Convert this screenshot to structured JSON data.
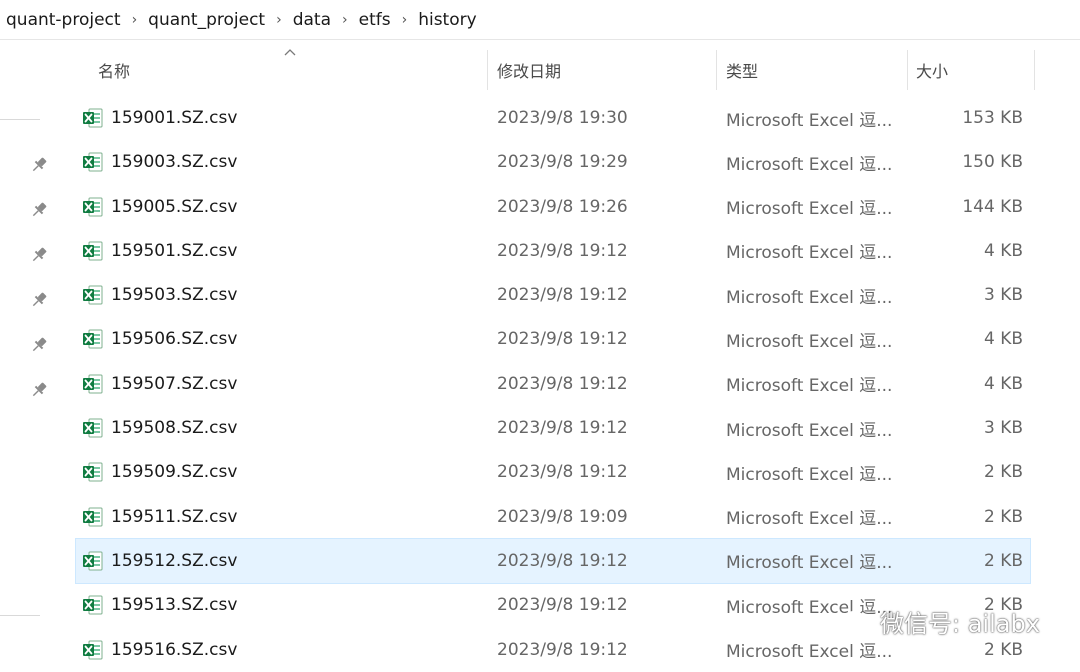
{
  "breadcrumb": {
    "items": [
      "quant-project",
      "quant_project",
      "data",
      "etfs",
      "history"
    ],
    "separator": "›"
  },
  "columns": {
    "name": "名称",
    "date": "修改日期",
    "type": "类型",
    "size": "大小"
  },
  "files": [
    {
      "name": "159001.SZ.csv",
      "date": "2023/9/8 19:30",
      "type": "Microsoft Excel 逗...",
      "size": "153 KB"
    },
    {
      "name": "159003.SZ.csv",
      "date": "2023/9/8 19:29",
      "type": "Microsoft Excel 逗...",
      "size": "150 KB"
    },
    {
      "name": "159005.SZ.csv",
      "date": "2023/9/8 19:26",
      "type": "Microsoft Excel 逗...",
      "size": "144 KB"
    },
    {
      "name": "159501.SZ.csv",
      "date": "2023/9/8 19:12",
      "type": "Microsoft Excel 逗...",
      "size": "4 KB"
    },
    {
      "name": "159503.SZ.csv",
      "date": "2023/9/8 19:12",
      "type": "Microsoft Excel 逗...",
      "size": "3 KB"
    },
    {
      "name": "159506.SZ.csv",
      "date": "2023/9/8 19:12",
      "type": "Microsoft Excel 逗...",
      "size": "4 KB"
    },
    {
      "name": "159507.SZ.csv",
      "date": "2023/9/8 19:12",
      "type": "Microsoft Excel 逗...",
      "size": "4 KB"
    },
    {
      "name": "159508.SZ.csv",
      "date": "2023/9/8 19:12",
      "type": "Microsoft Excel 逗...",
      "size": "3 KB"
    },
    {
      "name": "159509.SZ.csv",
      "date": "2023/9/8 19:12",
      "type": "Microsoft Excel 逗...",
      "size": "2 KB"
    },
    {
      "name": "159511.SZ.csv",
      "date": "2023/9/8 19:09",
      "type": "Microsoft Excel 逗...",
      "size": "2 KB"
    },
    {
      "name": "159512.SZ.csv",
      "date": "2023/9/8 19:12",
      "type": "Microsoft Excel 逗...",
      "size": "2 KB",
      "selected": true
    },
    {
      "name": "159513.SZ.csv",
      "date": "2023/9/8 19:12",
      "type": "Microsoft Excel 逗...",
      "size": "2 KB"
    },
    {
      "name": "159516.SZ.csv",
      "date": "2023/9/8 19:12",
      "type": "Microsoft Excel 逗...",
      "size": "2 KB"
    }
  ],
  "watermark": {
    "text": "微信号: ailabx"
  },
  "colors": {
    "selection": "#e5f3ff",
    "excel_green": "#107c41"
  },
  "icons": {
    "file": "excel-csv-icon",
    "pin": "pin-icon",
    "sort": "sort-ascending-caret-icon"
  }
}
